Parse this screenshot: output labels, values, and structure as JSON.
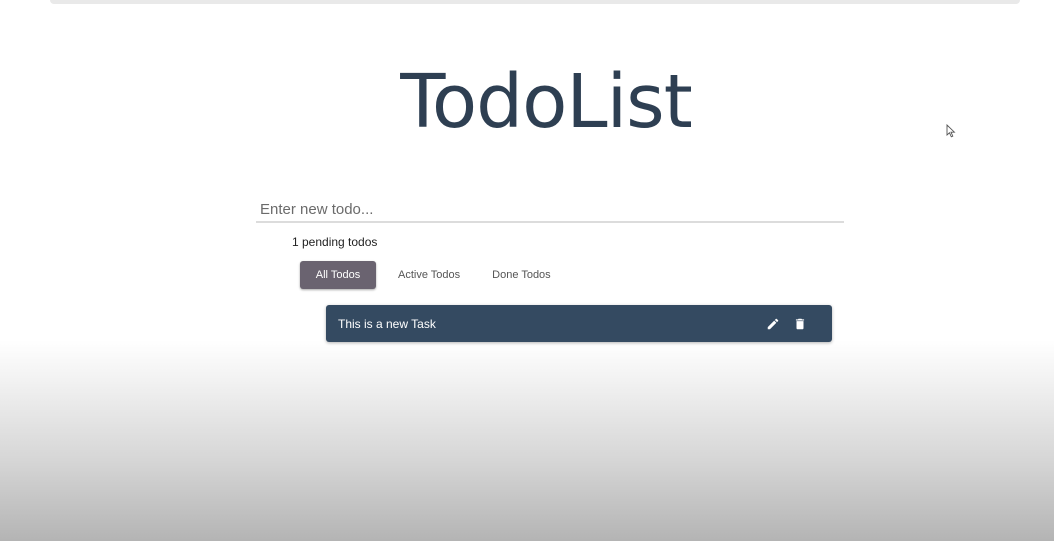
{
  "app": {
    "title": "TodoList"
  },
  "new_todo": {
    "placeholder": "Enter new todo...",
    "value": ""
  },
  "status": {
    "pending_text": "1 pending todos"
  },
  "filters": {
    "tabs": [
      {
        "label": "All Todos",
        "active": true
      },
      {
        "label": "Active Todos",
        "active": false
      },
      {
        "label": "Done Todos",
        "active": false
      }
    ]
  },
  "todos": [
    {
      "text": "This is a new Task",
      "actions": [
        "pencil-icon",
        "trash-icon"
      ]
    }
  ],
  "colors": {
    "title": "#2e3f52",
    "active_tab": "#6a6370",
    "todo_item": "#344a61"
  }
}
